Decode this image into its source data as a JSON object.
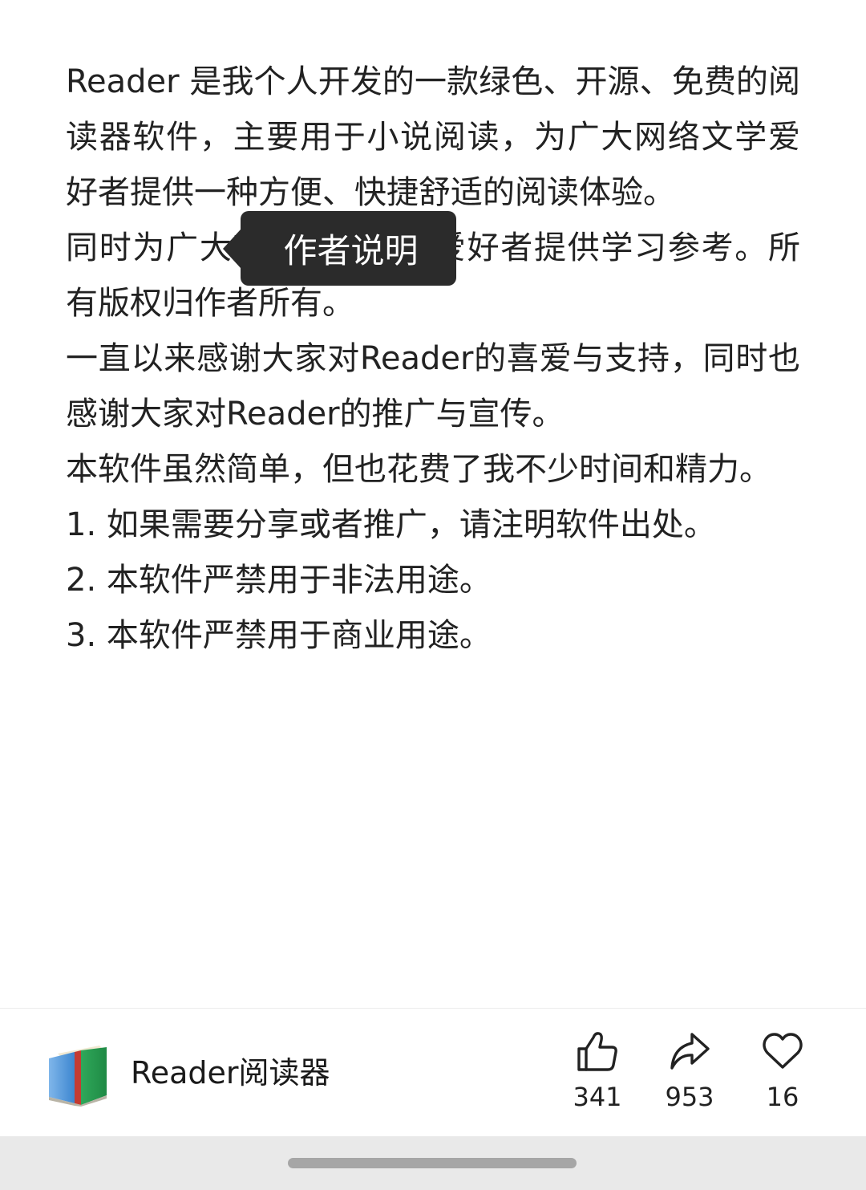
{
  "article": {
    "paragraphs": [
      "Reader 是我个人开发的一款绿色、开源、免费的阅读器软件，主要用于小说阅读，为广大网络文学爱好者提供一种方便、快捷舒适的阅读体验。",
      "同时为广大软件开发者、爱好者提供学习参考。所有版权归作者所有。",
      "一直以来感谢大家对Reader的喜爱与支持，同时也感谢大家对Reader的推广与宣传。",
      "本软件虽然简单，但也花费了我不少时间和精力。",
      "1. 如果需要分享或者推广，请注明软件出处。",
      "2. 本软件严禁用于非法用途。",
      "3. 本软件严禁用于商业用途。"
    ]
  },
  "tooltip": {
    "label": "作者说明"
  },
  "footer": {
    "app_name": "Reader阅读器",
    "logo_icon": "book-icon",
    "actions": {
      "like": {
        "icon": "thumbs-up-icon",
        "count": "341"
      },
      "share": {
        "icon": "share-arrow-icon",
        "count": "953"
      },
      "favorite": {
        "icon": "heart-icon",
        "count": "16"
      }
    }
  },
  "colors": {
    "text": "#222222",
    "tooltip_bg": "#2b2b2b",
    "nav_bar_bg": "#e9e9e9",
    "home_indicator": "#a6a6a6"
  }
}
